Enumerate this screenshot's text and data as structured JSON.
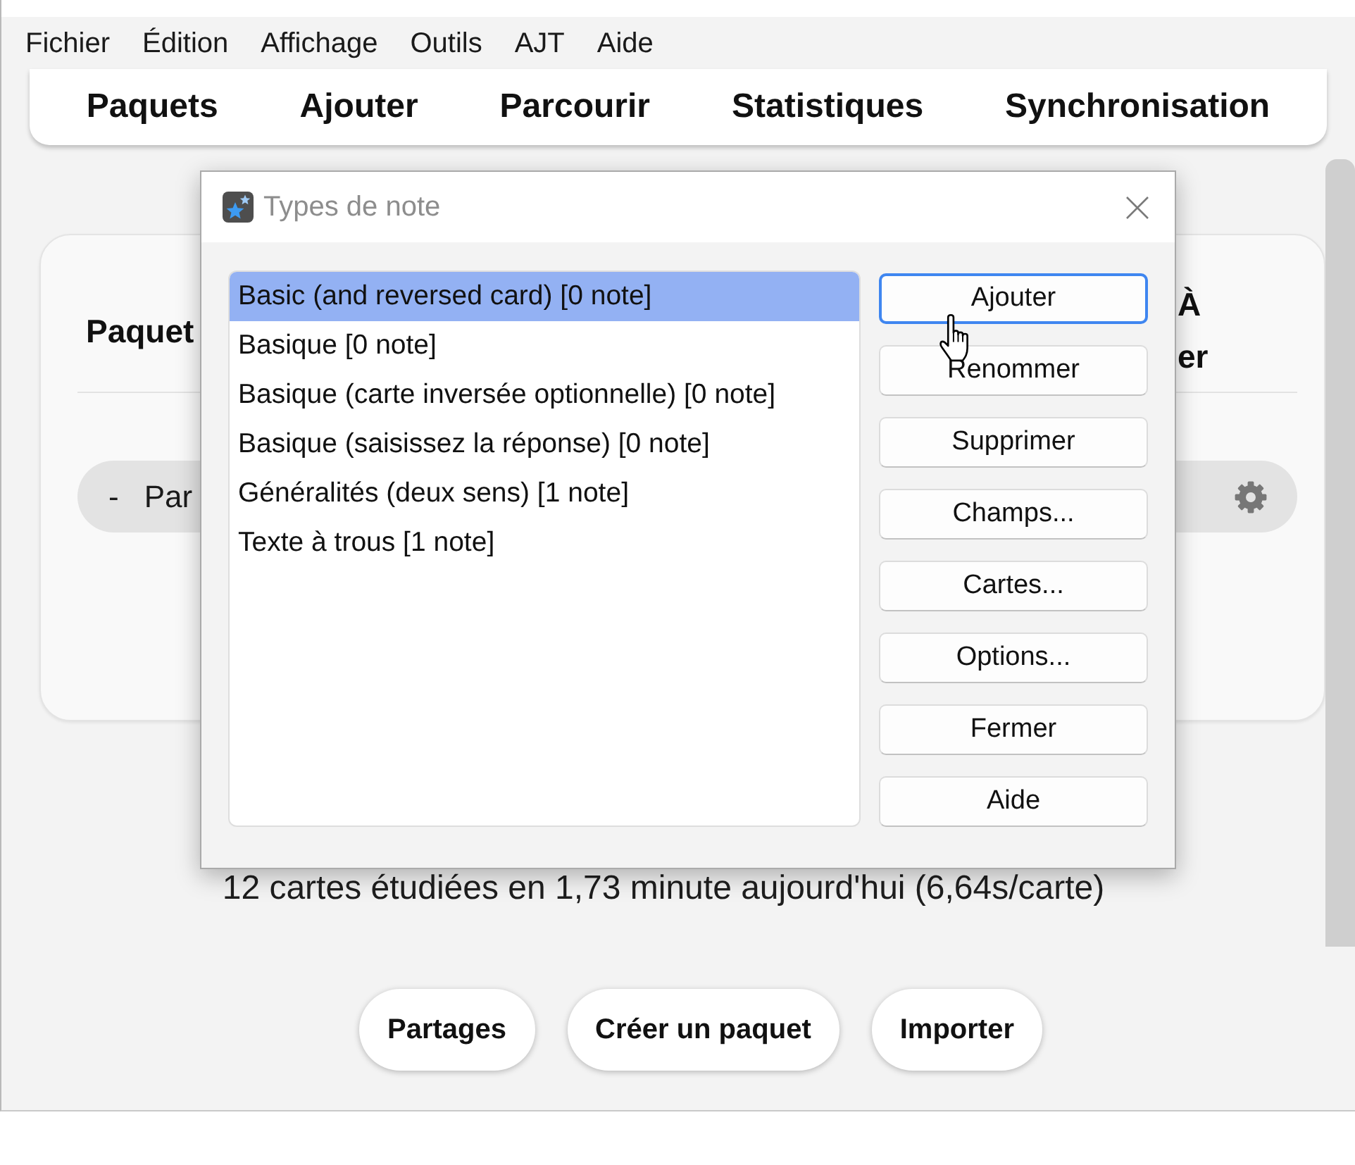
{
  "menu_bar": {
    "items": [
      "Fichier",
      "Édition",
      "Affichage",
      "Outils",
      "AJT",
      "Aide"
    ]
  },
  "toolbar": {
    "links": [
      "Paquets",
      "Ajouter",
      "Parcourir",
      "Statistiques",
      "Synchronisation"
    ]
  },
  "deck_table": {
    "columns": [
      {
        "lines": [
          "Paquet"
        ]
      },
      {
        "lines": [
          "À",
          "er"
        ]
      }
    ],
    "rows": [
      {
        "toggle": "-",
        "name": "Par"
      }
    ]
  },
  "stats": {
    "text": "12 cartes étudiées en 1,73 minute aujourd'hui (6,64s/carte)"
  },
  "bottom_buttons": [
    "Partages",
    "Créer un paquet",
    "Importer"
  ],
  "dialog": {
    "title": "Types de note",
    "note_types": [
      {
        "label": "Basic (and reversed card) [0 note]",
        "selected": true
      },
      {
        "label": "Basique [0 note]",
        "selected": false
      },
      {
        "label": "Basique (carte inversée optionnelle) [0 note]",
        "selected": false
      },
      {
        "label": "Basique (saisissez la réponse) [0 note]",
        "selected": false
      },
      {
        "label": "Généralités (deux sens) [1 note]",
        "selected": false
      },
      {
        "label": "Texte à trous [1 note]",
        "selected": false
      }
    ],
    "buttons": [
      {
        "label": "Ajouter",
        "focused": true
      },
      {
        "label": "Renommer",
        "focused": false
      },
      {
        "label": "Supprimer",
        "focused": false
      },
      {
        "label": "Champs...",
        "focused": false
      },
      {
        "label": "Cartes...",
        "focused": false
      },
      {
        "label": "Options...",
        "focused": false
      },
      {
        "label": "Fermer",
        "focused": false
      },
      {
        "label": "Aide",
        "focused": false
      }
    ]
  }
}
